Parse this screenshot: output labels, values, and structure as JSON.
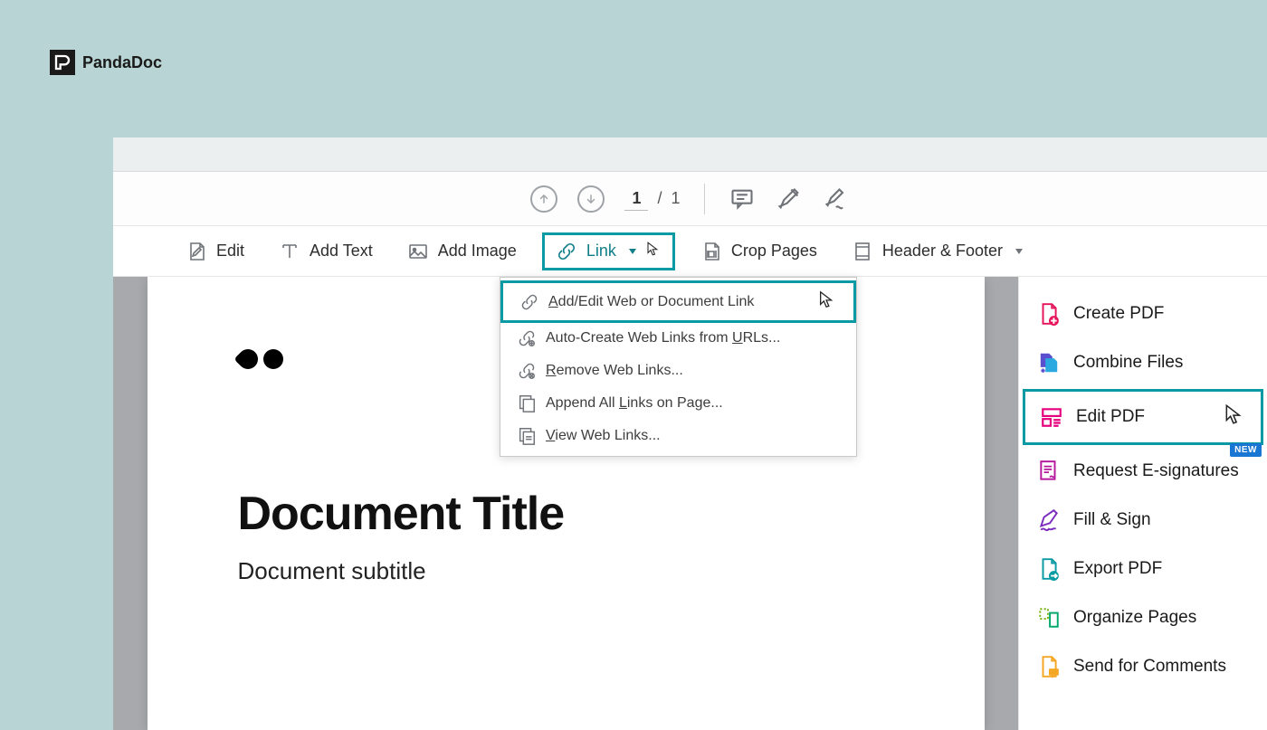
{
  "brand": {
    "name": "PandaDoc"
  },
  "topbar": {
    "current_page": "1",
    "page_sep": "/",
    "total_pages": "1"
  },
  "editbar": {
    "edit": "Edit",
    "add_text": "Add Text",
    "add_image": "Add Image",
    "link": "Link",
    "crop_pages": "Crop Pages",
    "header_footer": "Header & Footer"
  },
  "link_menu": {
    "items": [
      {
        "pre": "",
        "u": "A",
        "rest": "dd/Edit Web or Document Link"
      },
      {
        "pre": "Auto-Create Web Links from ",
        "u": "U",
        "rest": "RLs..."
      },
      {
        "pre": "",
        "u": "R",
        "rest": "emove Web Links..."
      },
      {
        "pre": "Append All ",
        "u": "L",
        "rest": "inks on Page..."
      },
      {
        "pre": "",
        "u": "V",
        "rest": "iew Web Links..."
      }
    ]
  },
  "document": {
    "title": "Document Title",
    "subtitle": "Document subtitle"
  },
  "sidebar": {
    "items": [
      {
        "label": "Create PDF"
      },
      {
        "label": "Combine Files"
      },
      {
        "label": "Edit PDF"
      },
      {
        "label": "Request E-signatures",
        "badge": "NEW"
      },
      {
        "label": "Fill & Sign"
      },
      {
        "label": "Export PDF"
      },
      {
        "label": "Organize Pages"
      },
      {
        "label": "Send for Comments"
      }
    ]
  }
}
